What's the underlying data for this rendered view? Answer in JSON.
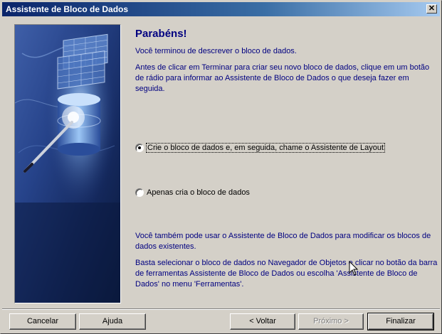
{
  "window": {
    "title": "Assistente de Bloco de Dados",
    "close_label": "✕"
  },
  "content": {
    "heading": "Parabéns!",
    "intro": "Você terminou de descrever o bloco de dados.",
    "instructions": "Antes de clicar em Terminar para criar seu novo bloco de dados, clique em um botão de rádio para informar ao Assistente de Bloco de Dados o que deseja fazer em seguida.",
    "options": [
      {
        "label": "Crie o bloco de dados e, em seguida, chame o Assistente de Layout",
        "checked": true
      },
      {
        "label": "Apenas cria o bloco de dados",
        "checked": false
      }
    ],
    "note1": "Você também pode usar o Assistente de Bloco de Dados para modificar os blocos de dados existentes.",
    "note2": "Basta selecionar o bloco de dados no Navegador de Objetos e clicar no botão da barra de ferramentas Assistente de Bloco de Dados ou escolha 'Assistente de Bloco de Dados' no menu 'Ferramentas'."
  },
  "buttons": {
    "cancel": "Cancelar",
    "help": "Ajuda",
    "back": "< Voltar",
    "next": "Próximo >",
    "finish": "Finalizar"
  },
  "graphic": {
    "icon": "database-wizard-illustration"
  }
}
